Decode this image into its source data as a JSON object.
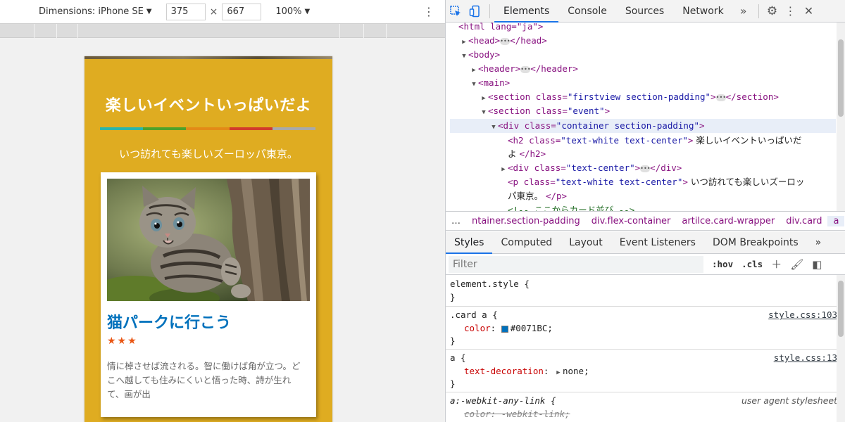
{
  "device_toolbar": {
    "dimensions_label": "Dimensions: iPhone SE",
    "width": "375",
    "height": "667",
    "times": "×",
    "zoom": "100%"
  },
  "page": {
    "title": "楽しいイベントいっぱいだよ",
    "subtitle": "いつ訪れても楽しいズーロッパ東京。",
    "bar_colors": [
      "#2bb5a9",
      "#4fa12a",
      "#e38a17",
      "#d23b2b",
      "#a9a9a9"
    ],
    "background_color": "#dfac21",
    "card": {
      "title": "猫パークに行こう",
      "stars": "★★★",
      "text": "情に棹させば流される。智に働けば角が立つ。どこへ越しても住みにくいと悟った時、詩が生れて、画が出",
      "title_color": "#0071BC"
    }
  },
  "devtools": {
    "tabs": [
      "Elements",
      "Console",
      "Sources",
      "Network"
    ],
    "more_tabs": "»",
    "dom": {
      "html_open": "<html lang=\"ja\">",
      "l1_tag": "<head>",
      "l1_close": "</head>",
      "l2": "<body>",
      "l3_tag": "<header>",
      "l3_close": "</header>",
      "l4": "<main>",
      "l5_open": "<section class=",
      "l5_class": "\"firstview section-padding\"",
      "l5_gt": ">",
      "l5_close": "</section>",
      "l6_open": "<section class=",
      "l6_class": "\"event\"",
      "l6_gt": ">",
      "l7_open": "<div class=",
      "l7_class": "\"container section-padding\"",
      "l7_gt": ">",
      "l8_open": "<h2 class=",
      "l8_class": "\"text-white text-center\"",
      "l8_gt": ">",
      "l8_text": " 楽しいイベントいっぱいだ",
      "l9_text": "よ ",
      "l9_close": "</h2>",
      "l10_open": "<div class=",
      "l10_class": "\"text-center\"",
      "l10_gt": ">",
      "l10_close": "</div>",
      "l11_open": "<p class=",
      "l11_class": "\"text-white text-center\"",
      "l11_gt": ">",
      "l11_text": " いつ訪れても楽しいズーロッ",
      "l12_text": "パ東京。 ",
      "l12_close": "</p>",
      "l13_comment": "<!-- ここからカード並び -->"
    },
    "breadcrumbs": [
      "…",
      "ntainer.section-padding",
      "div.flex-container",
      "artilce.card-wrapper",
      "div.card",
      "a",
      "…"
    ],
    "sub_tabs": [
      "Styles",
      "Computed",
      "Layout",
      "Event Listeners",
      "DOM Breakpoints"
    ],
    "sub_more": "»",
    "filter_placeholder": "Filter",
    "filter_hov": ":hov",
    "filter_cls": ".cls",
    "styles": {
      "r0_sel": "element.style {",
      "r0_close": "}",
      "r1_sel": ".card a {",
      "r1_src": "style.css:103",
      "r1_prop": "color",
      "r1_val": "#0071BC;",
      "r1_close": "}",
      "r2_sel": "a {",
      "r2_src": "style.css:13",
      "r2_prop": "text-decoration",
      "r2_val": "none;",
      "r2_close": "}",
      "r3_sel": "a:-webkit-any-link {",
      "r3_src": "user agent stylesheet",
      "r3_prop": "color",
      "r3_val": "-webkit-link;"
    }
  }
}
